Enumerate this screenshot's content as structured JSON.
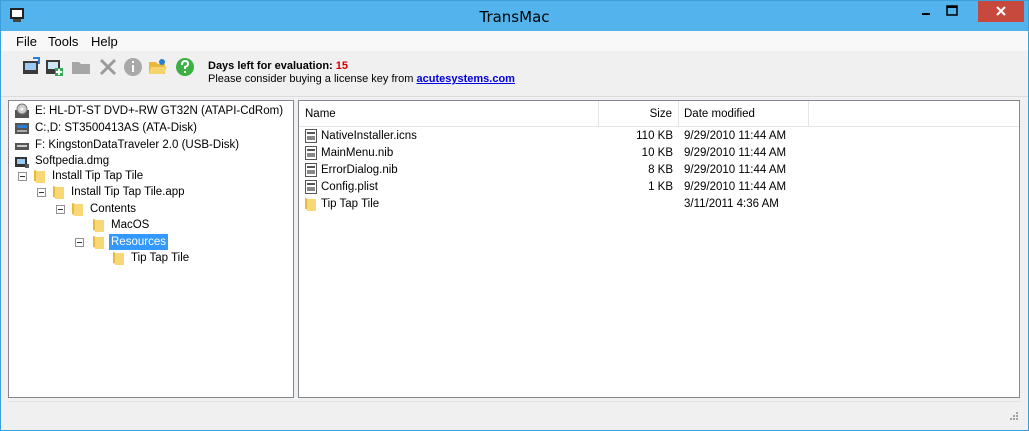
{
  "window": {
    "title": "TransMac"
  },
  "menu": {
    "items": [
      "File",
      "Tools",
      "Help"
    ]
  },
  "toolbar": {
    "icons": [
      "disk-image-icon",
      "add-icon",
      "folder-icon",
      "delete-icon",
      "info-icon",
      "open-folder-icon",
      "help-icon"
    ],
    "eval_label": "Days left for evaluation:",
    "eval_days": "15",
    "license_text": "Please consider buying a license key from",
    "license_link": "acutesystems.com"
  },
  "tree": {
    "drives": [
      {
        "label": "E: HL-DT-ST DVD+-RW GT32N (ATAPI-CdRom)",
        "icon": "cdrom-icon"
      },
      {
        "label": "C:,D: ST3500413AS (ATA-Disk)",
        "icon": "disk-icon"
      },
      {
        "label": "F: KingstonDataTraveler 2.0 (USB-Disk)",
        "icon": "usb-icon"
      },
      {
        "label": "Softpedia.dmg",
        "icon": "dmg-icon"
      }
    ],
    "folders": [
      {
        "label": "Install Tip Tap Tile"
      },
      {
        "label": "Install Tip Tap Tile.app"
      },
      {
        "label": "Contents"
      },
      {
        "label": "MacOS"
      },
      {
        "label": "Resources",
        "selected": true
      },
      {
        "label": "Tip Tap Tile"
      }
    ]
  },
  "list": {
    "columns": {
      "name": "Name",
      "size": "Size",
      "date": "Date modified"
    },
    "rows": [
      {
        "name": "NativeInstaller.icns",
        "size": "110 KB",
        "date": "9/29/2010 11:44 AM",
        "type": "file"
      },
      {
        "name": "MainMenu.nib",
        "size": "10 KB",
        "date": "9/29/2010 11:44 AM",
        "type": "file"
      },
      {
        "name": "ErrorDialog.nib",
        "size": "8 KB",
        "date": "9/29/2010 11:44 AM",
        "type": "file"
      },
      {
        "name": "Config.plist",
        "size": "1 KB",
        "date": "9/29/2010 11:44 AM",
        "type": "file"
      },
      {
        "name": "Tip Tap Tile",
        "size": "",
        "date": "3/11/2011 4:36 AM",
        "type": "folder"
      }
    ]
  },
  "colors": {
    "titlebar": "#53b3ec",
    "close": "#c7493e",
    "selection": "#3399ff",
    "link": "#0000e0",
    "eval_days": "#d10000"
  }
}
